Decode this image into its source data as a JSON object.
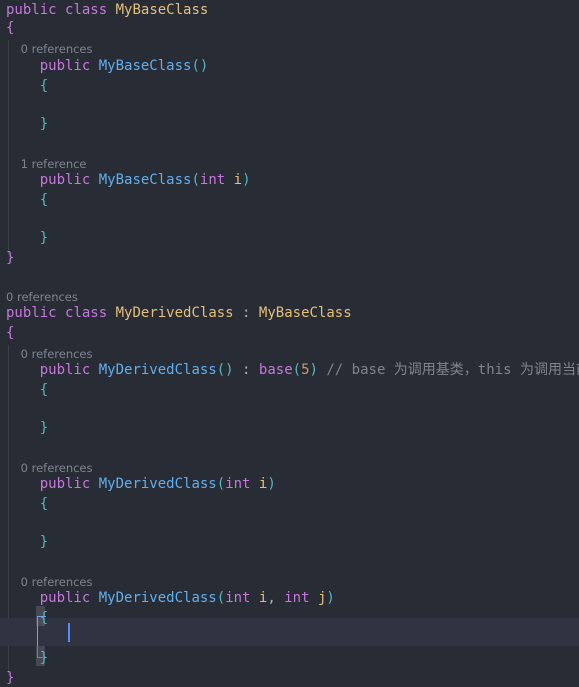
{
  "editor": {
    "theme_name": "dark-plus",
    "background_color": "#282c34",
    "current_line_color": "#2f3440",
    "cursor_color": "#528bff",
    "indent_guide_color": "#3b4048",
    "bracket_highlight_color": "#5c6370",
    "bracket_guide_color": "#6aa6e8"
  },
  "codelens": {
    "base_ctor_default": "0 references",
    "base_ctor_int": "1 reference",
    "derived_class": "0 references",
    "derived_ctor_default": "0 references",
    "derived_ctor_int": "0 references",
    "derived_ctor_int_int": "0 references"
  },
  "tokens": {
    "public": "public",
    "class": "class",
    "int": "int",
    "base": "base",
    "this": "this",
    "my_base_class": "MyBaseClass",
    "my_derived_class": "MyDerivedClass",
    "open_paren": "(",
    "close_paren": ")",
    "open_brace": "{",
    "close_brace": "}",
    "colon": " : ",
    "comma": ", ",
    "space": " ",
    "param_i": "i",
    "param_j": "j",
    "literal_5": "5",
    "empty_args": "()",
    "comment_base_this": "// base 为调用基类，this 为调用当前类"
  }
}
